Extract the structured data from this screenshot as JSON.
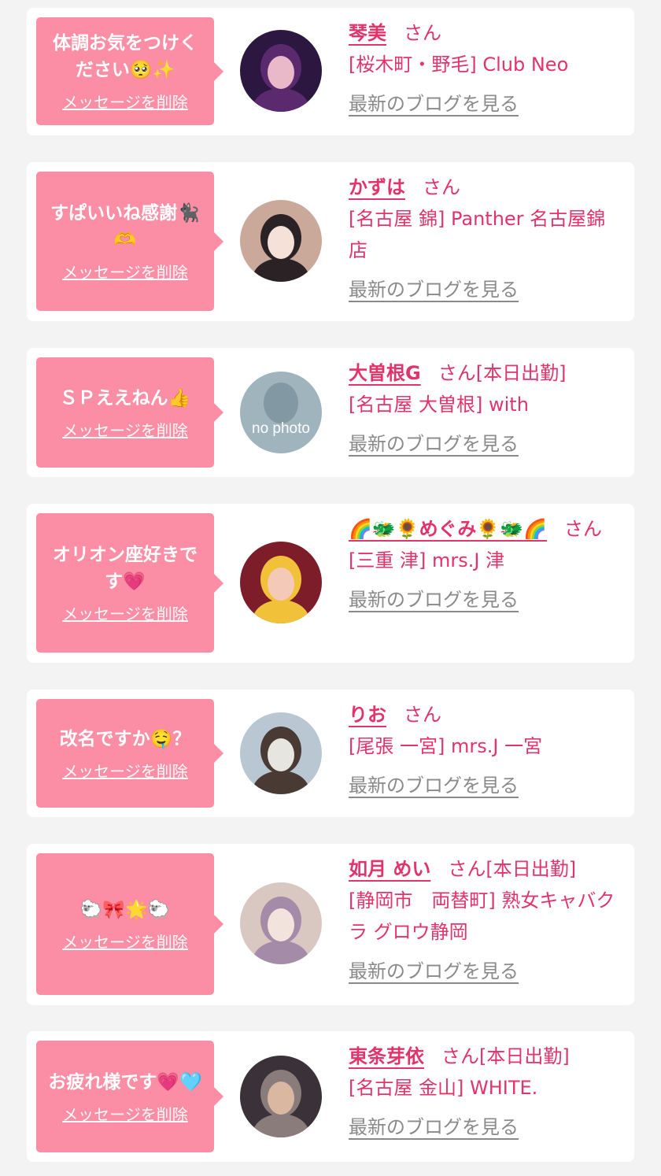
{
  "delete_label": "メッセージを削除",
  "blog_label": "最新のブログを見る",
  "san_label": "さん",
  "cards": [
    {
      "message": "体調お気をつけください🥺✨",
      "name": "琴美",
      "badge": "",
      "shop": "[桜木町・野毛] Club Neo",
      "avatar_desc": "profile-photo",
      "no_photo": ""
    },
    {
      "message": "すぱいいね感謝🐈‍⬛🫶",
      "name": "かずは",
      "badge": "",
      "shop": "[名古屋 錦] Panther 名古屋錦店",
      "avatar_desc": "profile-photo",
      "no_photo": ""
    },
    {
      "message": "ＳＰええねん👍",
      "name": "大曽根G",
      "badge": "[本日出勤]",
      "shop": "[名古屋 大曽根] with",
      "avatar_desc": "no-photo-placeholder",
      "no_photo": "no photo"
    },
    {
      "message": "オリオン座好きです💗",
      "name": "🌈🐲🌻めぐみ🌻🐲🌈",
      "badge": "",
      "shop": "[三重 津] mrs.J 津",
      "avatar_desc": "profile-photo",
      "no_photo": ""
    },
    {
      "message": "改名ですか🤤？",
      "name": "りお",
      "badge": "",
      "shop": "[尾張 一宮] mrs.J 一宮",
      "avatar_desc": "profile-photo",
      "no_photo": ""
    },
    {
      "message": "🐑🎀🌟🐑",
      "name": "如月 めい",
      "badge": "[本日出勤]",
      "shop": "[静岡市　両替町] 熟女キャバクラ グロウ静岡",
      "avatar_desc": "profile-photo",
      "no_photo": ""
    },
    {
      "message": "お疲れ様です💗🩵",
      "name": "東条芽依",
      "badge": "[本日出勤]",
      "shop": "[名古屋 金山] WHITE.",
      "avatar_desc": "profile-photo",
      "no_photo": ""
    }
  ],
  "colors": {
    "page_bg": "#f3f3f3",
    "card_bg": "#ffffff",
    "bubble": "#fb8ea4",
    "accent_text": "#e2336b",
    "link_gray": "#8a8a8a"
  }
}
